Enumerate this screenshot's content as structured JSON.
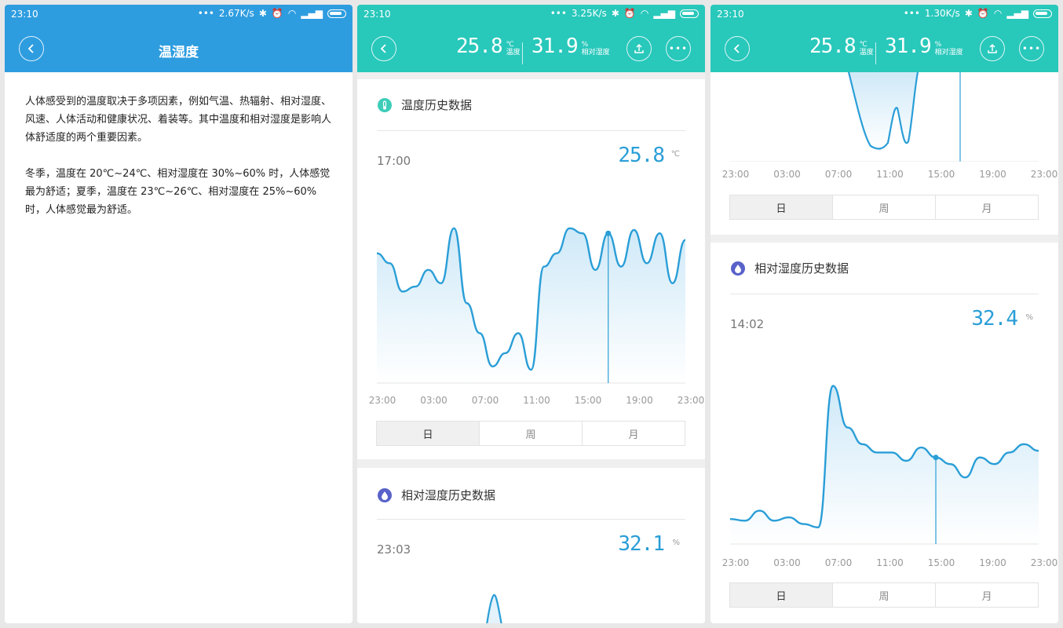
{
  "screens": [
    {
      "status": {
        "time": "23:10",
        "speed": "2.67K/s"
      },
      "title": "温湿度",
      "paragraphs": [
        "人体感受到的温度取决于多项因素，例如气温、热辐射、相对湿度、风速、人体活动和健康状况、着装等。其中温度和相对湿度是影响人体舒适度的两个重要因素。",
        "冬季，温度在 20℃~24℃、相对湿度在 30%~60% 时，人体感觉最为舒适；夏季，温度在 23℃~26℃、相对湿度在 25%~60% 时，人体感觉最为舒适。"
      ]
    },
    {
      "status": {
        "time": "23:10",
        "speed": "3.25K/s"
      },
      "header": {
        "temp": "25.8",
        "temp_unit": "℃",
        "temp_label": "温度",
        "hum": "31.9",
        "hum_unit": "%",
        "hum_label": "相对湿度"
      },
      "temp_card": {
        "title": "温度历史数据",
        "time": "17:00",
        "value": "25.8",
        "unit": "℃"
      },
      "hum_card": {
        "title": "相对湿度历史数据",
        "time": "23:03",
        "value": "32.1",
        "unit": "%"
      },
      "x_ticks": [
        "23:00",
        "03:00",
        "07:00",
        "11:00",
        "15:00",
        "19:00",
        "23:00"
      ],
      "tabs": [
        "日",
        "周",
        "月"
      ],
      "active_tab": 0
    },
    {
      "status": {
        "time": "23:10",
        "speed": "1.30K/s"
      },
      "header": {
        "temp": "25.8",
        "temp_unit": "℃",
        "temp_label": "温度",
        "hum": "31.9",
        "hum_unit": "%",
        "hum_label": "相对湿度"
      },
      "temp_card": {
        "x_ticks": [
          "23:00",
          "03:00",
          "07:00",
          "11:00",
          "15:00",
          "19:00",
          "23:00"
        ]
      },
      "hum_card": {
        "title": "相对湿度历史数据",
        "time": "14:02",
        "value": "32.4",
        "unit": "%"
      },
      "x_ticks": [
        "23:00",
        "03:00",
        "07:00",
        "11:00",
        "15:00",
        "19:00",
        "23:00"
      ],
      "tabs": [
        "日",
        "周",
        "月"
      ],
      "active_tab": 0
    }
  ],
  "colors": {
    "blue_header": "#2e9de0",
    "teal_header": "#28c8bb",
    "line": "#2a9ed7",
    "temp_icon": "#3dcdb9",
    "hum_icon": "#5862c9"
  },
  "chart_data": [
    {
      "type": "area",
      "name": "temperature-day",
      "x": [
        "23:00",
        "00:00",
        "01:00",
        "02:00",
        "03:00",
        "04:00",
        "05:00",
        "06:00",
        "07:00",
        "08:00",
        "09:00",
        "10:00",
        "11:00",
        "12:00",
        "13:00",
        "14:00",
        "15:00",
        "16:00",
        "17:00",
        "18:00",
        "19:00",
        "20:00",
        "21:00",
        "22:00",
        "23:00"
      ],
      "values": [
        0.78,
        0.72,
        0.55,
        0.58,
        0.68,
        0.6,
        0.93,
        0.48,
        0.3,
        0.1,
        0.18,
        0.3,
        0.08,
        0.7,
        0.78,
        0.93,
        0.9,
        0.68,
        0.9,
        0.7,
        0.92,
        0.72,
        0.9,
        0.6,
        0.86
      ],
      "selected_x": "17:00",
      "selected_value": "25.8"
    },
    {
      "type": "area",
      "name": "humidity-day",
      "x": [
        "23:00",
        "00:00",
        "01:00",
        "02:00",
        "03:00",
        "04:00",
        "05:00",
        "06:00",
        "07:00",
        "08:00",
        "09:00",
        "10:00",
        "11:00",
        "12:00",
        "13:00",
        "14:00",
        "15:00",
        "16:00",
        "17:00",
        "18:00",
        "19:00",
        "20:00",
        "21:00",
        "22:00",
        "23:00"
      ],
      "values": [
        0.15,
        0.14,
        0.2,
        0.14,
        0.16,
        0.12,
        0.1,
        0.95,
        0.7,
        0.6,
        0.55,
        0.55,
        0.5,
        0.58,
        0.52,
        0.48,
        0.4,
        0.52,
        0.48,
        0.55,
        0.6,
        0.56
      ],
      "selected_x": "14:02",
      "selected_value": "32.4"
    }
  ]
}
